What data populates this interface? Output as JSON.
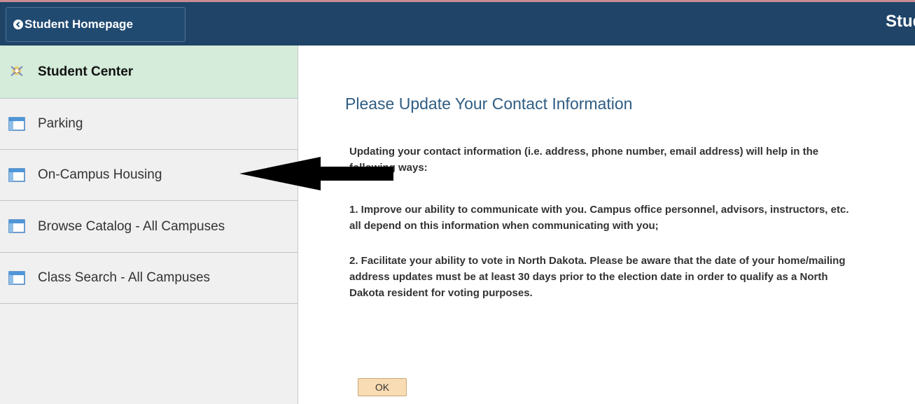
{
  "header": {
    "back_label": "Student Homepage",
    "title": "Student Center",
    "bar_color": "#1f4468"
  },
  "sidebar": {
    "items": [
      {
        "label": "Student Center",
        "icon": "student-center-icon",
        "active": true
      },
      {
        "label": "Parking",
        "icon": "page-icon"
      },
      {
        "label": "On-Campus Housing",
        "icon": "page-icon"
      },
      {
        "label": "Browse Catalog - All Campuses",
        "icon": "page-icon"
      },
      {
        "label": "Class Search - All Campuses",
        "icon": "page-icon"
      }
    ],
    "active_color": "#d4ecd9"
  },
  "main": {
    "heading": "Please Update Your Contact Information",
    "paragraphs": [
      "Updating your contact information (i.e. address, phone number, email address) will help in the following ways:",
      "1. Improve our ability to communicate with you. Campus office personnel, advisors, instructors, etc. all depend on this information when communicating with you;",
      "2. Facilitate your ability to vote in North Dakota. Please be aware that the date of your home/mailing address updates must be at least 30 days prior to the election date in order to qualify as a North Dakota resident for voting purposes."
    ],
    "ok_label": "OK",
    "heading_color": "#2f5d83"
  },
  "annotation": {
    "arrow_icon": "arrow-left-icon",
    "color": "#000000"
  }
}
